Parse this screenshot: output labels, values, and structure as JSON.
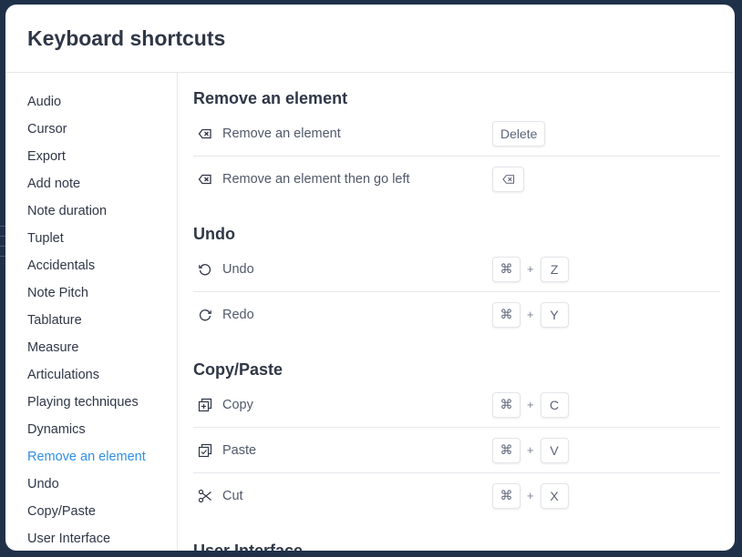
{
  "modal": {
    "title": "Keyboard shortcuts"
  },
  "sidebar": {
    "active_index": 13,
    "items": [
      {
        "label": "Audio"
      },
      {
        "label": "Cursor"
      },
      {
        "label": "Export"
      },
      {
        "label": "Add note"
      },
      {
        "label": "Note duration"
      },
      {
        "label": "Tuplet"
      },
      {
        "label": "Accidentals"
      },
      {
        "label": "Note Pitch"
      },
      {
        "label": "Tablature"
      },
      {
        "label": "Measure"
      },
      {
        "label": "Articulations"
      },
      {
        "label": "Playing techniques"
      },
      {
        "label": "Dynamics"
      },
      {
        "label": "Remove an element"
      },
      {
        "label": "Undo"
      },
      {
        "label": "Copy/Paste"
      },
      {
        "label": "User Interface"
      }
    ]
  },
  "sections": [
    {
      "title": "Remove an element",
      "shortcuts": [
        {
          "icon": "backspace-icon",
          "label": "Remove an element",
          "keys": [
            "Delete"
          ],
          "separator": "+"
        },
        {
          "icon": "backspace-icon",
          "label": "Remove an element then go left",
          "keys": [
            "backspace-key-icon"
          ],
          "separator": "+"
        }
      ]
    },
    {
      "title": "Undo",
      "shortcuts": [
        {
          "icon": "undo-icon",
          "label": "Undo",
          "keys": [
            "⌘",
            "Z"
          ],
          "separator": "+"
        },
        {
          "icon": "redo-icon",
          "label": "Redo",
          "keys": [
            "⌘",
            "Y"
          ],
          "separator": "+"
        }
      ]
    },
    {
      "title": "Copy/Paste",
      "shortcuts": [
        {
          "icon": "copy-icon",
          "label": "Copy",
          "keys": [
            "⌘",
            "C"
          ],
          "separator": "+"
        },
        {
          "icon": "paste-icon",
          "label": "Paste",
          "keys": [
            "⌘",
            "V"
          ],
          "separator": "+"
        },
        {
          "icon": "scissors-icon",
          "label": "Cut",
          "keys": [
            "⌘",
            "X"
          ],
          "separator": "+"
        }
      ]
    },
    {
      "title": "User Interface",
      "shortcuts": []
    }
  ],
  "colors": {
    "accent": "#2e8fe6",
    "text": "#2f3747",
    "muted": "#50596a",
    "backdrop": "#1f3049"
  }
}
